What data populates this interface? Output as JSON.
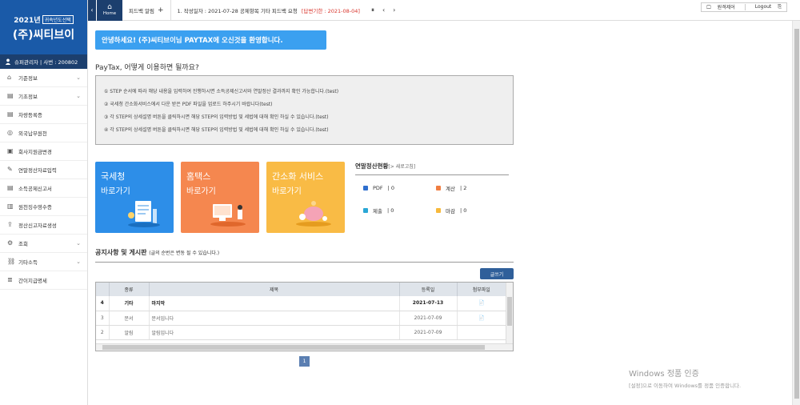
{
  "brand": {
    "year": "2021년",
    "tag": "귀속년도선택",
    "company": "(주)씨티브이"
  },
  "user": {
    "label": "슈퍼관리자 | 사번 : 200802"
  },
  "menu": [
    {
      "label": "기준정보",
      "icon": "home-icon",
      "chev": true
    },
    {
      "label": "기초정보",
      "icon": "document-icon",
      "chev": true
    },
    {
      "label": "차량등록증",
      "icon": "document-icon",
      "chev": false
    },
    {
      "label": "외국납부원천",
      "icon": "globe-icon",
      "chev": false
    },
    {
      "label": "회사지원금변경",
      "icon": "money-icon",
      "chev": false
    },
    {
      "label": "연말정산자료입력",
      "icon": "edit-icon",
      "chev": false
    },
    {
      "label": "소득공제신고서",
      "icon": "document-icon",
      "chev": false
    },
    {
      "label": "원천징수영수증",
      "icon": "receipt-icon",
      "chev": false
    },
    {
      "label": "정산신고자료생성",
      "icon": "export-icon",
      "chev": false
    },
    {
      "label": "조회",
      "icon": "gear-icon",
      "chev": true
    },
    {
      "label": "기타소득",
      "icon": "link-icon",
      "chev": true
    },
    {
      "label": "간이지급명세",
      "icon": "list-icon",
      "chev": false
    }
  ],
  "topbar": {
    "collapse": "‹",
    "home": "Home",
    "tab": "피드백 알림",
    "tab_add": "+",
    "notice": "1. 작성일자 : 2021-07-28 공제항목 기타 피드백 요청",
    "deadline": "[답변기한 : 2021-08-04]",
    "pause": "⏸",
    "prev": "‹",
    "next": "›",
    "remote": "원격제어",
    "logout": "Logout"
  },
  "welcome": "안녕하세요! (주)씨티브이님 PAYTAX에 오신것을 환영합니다.",
  "guide": {
    "title": "PayTax, 어떻게 이용하면 될까요?",
    "lines": [
      "① STEP 순서에 따라 해당 내용을 입력하여 진행하시면 소득공제신고서와 연말정산 결과까지 확인 가능합니다.(test)",
      "② 국세청 간소화서비스에서 다운 받은 PDF 파일을 업로드 하주시기 바랍니다(test)",
      "③ 각 STEP의 상세설명 버튼을 클릭하시면 해당 STEP의 입력방법 및 세법에 대해 확인 하실 수 있습니다.(test)",
      "④ 각 STEP의 상세설명 버튼을 클릭하시면 해당 STEP의 입력방법 및 세법에 대해 확인 하실 수 있습니다.(test)"
    ]
  },
  "cards": [
    {
      "title": "국세청",
      "sub": "바로가기"
    },
    {
      "title": "홈택스",
      "sub": "바로가기"
    },
    {
      "title": "간소화 서비스",
      "sub": "바로가기"
    }
  ],
  "status": {
    "title": "연말정산현황",
    "refresh": "[> 새로고침]",
    "items": [
      {
        "label": "PDF",
        "value": "| 0",
        "color": "#2f6fce"
      },
      {
        "label": "계산",
        "value": "| 2",
        "color": "#f07e42"
      },
      {
        "label": "제출",
        "value": "| 0",
        "color": "#2aa7d6"
      },
      {
        "label": "마감",
        "value": "| 0",
        "color": "#f7b93c"
      }
    ]
  },
  "board": {
    "title": "공지사항 및 게시판",
    "note": "(글의 순번은 변동 될 수 있습니다.)",
    "write": "글쓰기",
    "columns": [
      "",
      "종류",
      "제목",
      "등록일",
      "첨부파일"
    ],
    "rows": [
      {
        "no": "4",
        "type": "기타",
        "subject": "마지막",
        "date": "2021-07-13",
        "file": "📄"
      },
      {
        "no": "3",
        "type": "문서",
        "subject": "문서입니다",
        "date": "2021-07-09",
        "file": "📄"
      },
      {
        "no": "2",
        "type": "알림",
        "subject": "알림입니다",
        "date": "2021-07-09",
        "file": ""
      }
    ],
    "page": "1"
  },
  "windows": {
    "title": "Windows 정품 인증",
    "sub": "[설정]으로 이동하여 Windows를 정품 인증합니다."
  }
}
